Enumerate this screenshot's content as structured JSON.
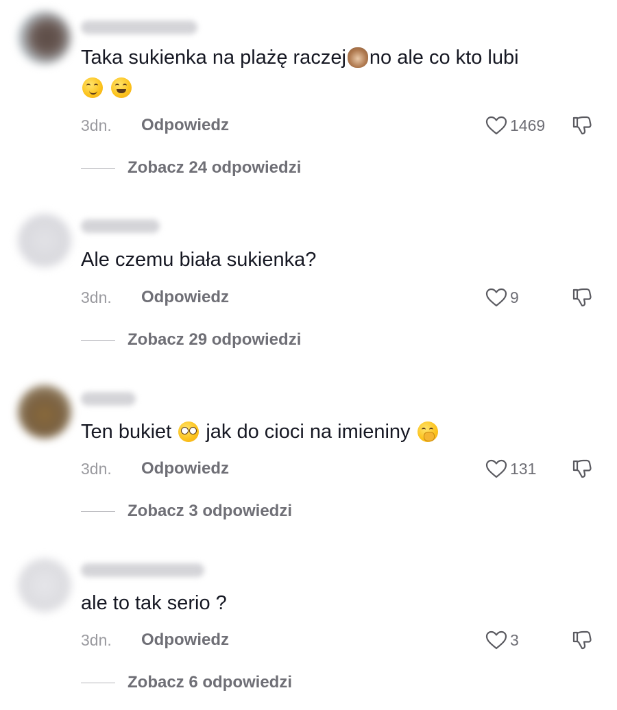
{
  "comments": [
    {
      "text_a": "Taka sukienka na plażę raczej",
      "emoji_a": "see-no-evil-monkey",
      "text_b": "no ale co kto lubi",
      "emoji_b": "smirking-face",
      "emoji_c": "grinning-face",
      "time": "3dn.",
      "reply_label": "Odpowiedz",
      "likes": "1469",
      "view_replies": "Zobacz 24 odpowiedzi"
    },
    {
      "text_a": "Ale czemu biała sukienka?",
      "time": "3dn.",
      "reply_label": "Odpowiedz",
      "likes": "9",
      "view_replies": "Zobacz 29 odpowiedzi"
    },
    {
      "text_a": "Ten bukiet",
      "emoji_a": "flushed-face",
      "text_b": "jak do cioci na imieniny",
      "emoji_b": "face-with-hand-over-mouth",
      "time": "3dn.",
      "reply_label": "Odpowiedz",
      "likes": "131",
      "view_replies": "Zobacz 3 odpowiedzi"
    },
    {
      "text_a": "ale to tak serio ?",
      "time": "3dn.",
      "reply_label": "Odpowiedz",
      "likes": "3",
      "view_replies": "Zobacz 6 odpowiedzi"
    }
  ]
}
